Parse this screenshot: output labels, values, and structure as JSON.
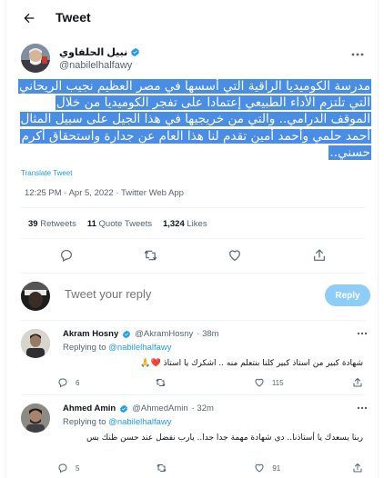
{
  "header": {
    "title": "Tweet"
  },
  "author": {
    "name": "نبيل الحلفاوي",
    "handle": "@nabilelhalfawy"
  },
  "tweet": {
    "text": "مدرسة الكوميديا الراقية التي أسسها في مصر العظيم نجيب الريحاني التي تلتزم الأداء الطبيعي إعتمادا على تفجر الكوميديا من خلال الموقف الدرامي.. والتي من خريجيها في هذا الجيل على سبيل المثال أحمد حلمي وأحمد أمين تقدم لنا هذا العام عن جدارة واستحقاق أكرم حسني..",
    "translate_label": "Translate Tweet",
    "meta": "12:25 PM · Apr 5, 2022 · Twitter Web App"
  },
  "stats": [
    {
      "count": "39",
      "label": "Retweets"
    },
    {
      "count": "11",
      "label": "Quote Tweets"
    },
    {
      "count": "1,324",
      "label": "Likes"
    }
  ],
  "composer": {
    "placeholder": "Tweet your reply",
    "button_label": "Reply"
  },
  "replies": [
    {
      "name": "Akram Hosny",
      "handle": "@AkramHosny",
      "time": "· 38m",
      "replying_prefix": "Replying to",
      "replying_to": "@nabilelhalfawy",
      "text": "شهادة كبير من استاذ كبير كلنا بنتعلم منه .. اشكرك يا استاذ ❤️🙏",
      "reply_count": "6",
      "retweet_count": "",
      "like_count": "115"
    },
    {
      "name": "Ahmed Amin",
      "handle": "@AhmedAmin",
      "time": "· 32m",
      "replying_prefix": "Replying to",
      "replying_to": "@nabilelhalfawy",
      "text": "ربنا يسعدك يا أستاذنا.. دي شهادة مهمة جدا جدا.. يارب نفضل عند حسن ظنك بس",
      "reply_count": "5",
      "retweet_count": "",
      "like_count": "91"
    }
  ],
  "colors": {
    "accent": "#1d9bf0",
    "highlight": "#4a8de5",
    "verified": "#1d9bf0"
  }
}
